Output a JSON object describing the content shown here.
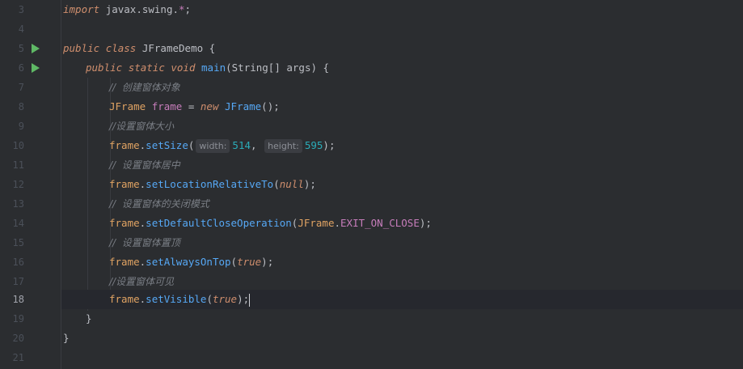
{
  "editor": {
    "lines": [
      {
        "no": "3"
      },
      {
        "no": "4"
      },
      {
        "no": "5"
      },
      {
        "no": "6"
      },
      {
        "no": "7"
      },
      {
        "no": "8"
      },
      {
        "no": "9"
      },
      {
        "no": "10"
      },
      {
        "no": "11"
      },
      {
        "no": "12"
      },
      {
        "no": "13"
      },
      {
        "no": "14"
      },
      {
        "no": "15"
      },
      {
        "no": "16"
      },
      {
        "no": "17"
      },
      {
        "no": "18"
      },
      {
        "no": "19"
      },
      {
        "no": "20"
      },
      {
        "no": "21"
      }
    ],
    "tokens": {
      "import_kw": "import",
      "import_pkg": "javax.swing.",
      "import_star": "*",
      "import_semi": ";",
      "public1": "public",
      "class_kw": "class",
      "class_name": "JFrameDemo",
      "brace_open1": "{",
      "public2": "public",
      "static_kw": "static",
      "void_kw": "void",
      "main_fn": "main",
      "main_args": "(String[] args) {",
      "c7": "//  创建窗体对象",
      "jframe_type": "JFrame",
      "frame_var": "frame",
      "assign": " = ",
      "new_kw": "new",
      "jframe_ctor": "JFrame",
      "ctor_end": "();",
      "c9": "//设置窗体大小",
      "frame10": "frame",
      "setSize": "setSize",
      "hint_width": "width:",
      "val_width": "514",
      "hint_height": "height:",
      "val_height": "595",
      "end10": ");",
      "c11": "//  设置窗体居中",
      "frame12": "frame",
      "setLoc": "setLocationRelativeTo",
      "null_kw": "null",
      "end12": ");",
      "c13": "//  设置窗体的关闭模式",
      "frame14": "frame",
      "setClose": "setDefaultCloseOperation",
      "jframe14": "JFrame",
      "exit_const": "EXIT_ON_CLOSE",
      "end14": ");",
      "c15": "//  设置窗体置顶",
      "frame16": "frame",
      "setTop": "setAlwaysOnTop",
      "true16": "true",
      "end16": ");",
      "c17": "//设置窗体可见",
      "frame18": "frame",
      "setVisible": "setVisible",
      "true18": "true",
      "end18": ");",
      "brace19": "}",
      "brace20": "}"
    },
    "colors": {
      "background": "#2b2d30",
      "keyword": "#cf8e6d",
      "function": "#56a8f5",
      "comment": "#7a7e85",
      "number": "#2aacb8",
      "field": "#c77dbb",
      "run_icon": "#5fb865"
    },
    "icons": {
      "run_line5": "run-gutter-icon",
      "run_line6": "run-gutter-icon"
    }
  }
}
